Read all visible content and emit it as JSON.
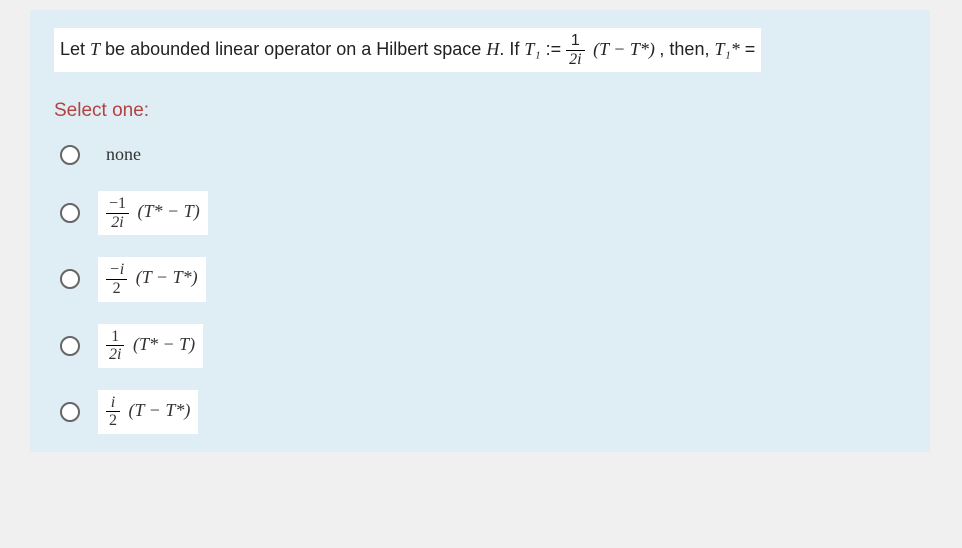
{
  "question": {
    "prefix": "Let ",
    "var_T": "T",
    "mid1": "  be abounded linear operator on a Hilbert space ",
    "var_H": "H",
    "mid2": ". If ",
    "T1": "T₁",
    "assign": " := ",
    "frac_num": "1",
    "frac_den": "2i",
    "expr": " (T − T*) ",
    "mid3": ", then,  ",
    "T1star": "T₁*",
    "eq": " ="
  },
  "select_label": "Select one:",
  "options": {
    "a": {
      "text": "none"
    },
    "b": {
      "num": "−1",
      "den": "2i",
      "expr": "(T* − T)"
    },
    "c": {
      "num": "−i",
      "den": "2",
      "expr": "(T − T*)"
    },
    "d": {
      "num": "1",
      "den": "2i",
      "expr": "(T* − T)"
    },
    "e": {
      "num": "i",
      "den": "2",
      "expr": "(T − T*)"
    }
  }
}
